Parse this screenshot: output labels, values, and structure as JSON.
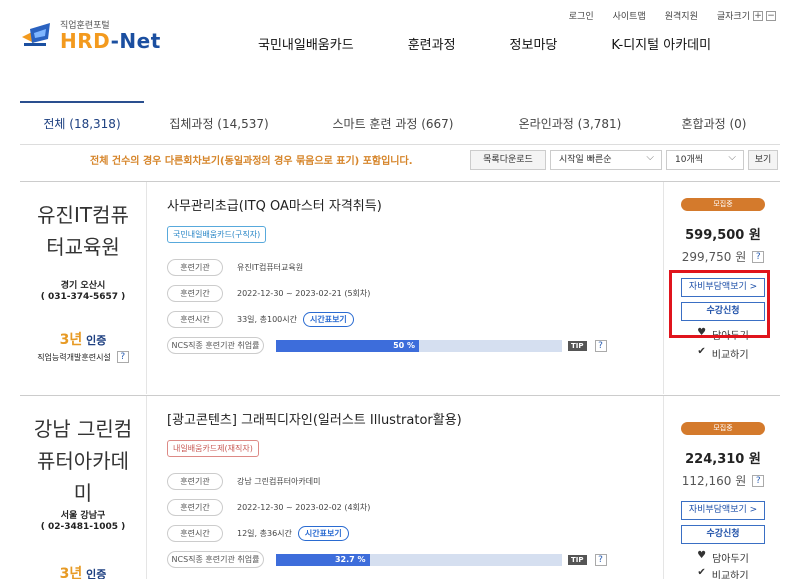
{
  "top_links": [
    "로그인",
    "사이트맵",
    "원격지원"
  ],
  "font_size": {
    "label": "글자크기",
    "plus": "+",
    "minus": "−"
  },
  "logo": {
    "sub": "직업훈련포털",
    "main_a": "HRD",
    "main_b": "-Net"
  },
  "gnb": [
    "국민내일배움카드",
    "훈련과정",
    "정보마당",
    "K-디지털 아카데미"
  ],
  "tabs": [
    "전체 (18,318)",
    "집체과정 (14,537)",
    "스마트 훈련 과정 (667)",
    "온라인과정 (3,781)",
    "혼합과정 (0)"
  ],
  "notice": "전체 건수의 경우 다른회차보기(동일과정의 경우 묶음으로 표기) 포함입니다.",
  "controls": {
    "download": "목록다운로드",
    "sort": "시작일 빠른순",
    "count": "10개씩",
    "view": "보기"
  },
  "labels": {
    "institution": "훈련기관",
    "period": "훈련기간",
    "hours": "훈련시간",
    "schedule": "시간표보기",
    "ncs": "NCS직종 훈련기관 취업률",
    "tip": "TIP",
    "recruiting": "모집중",
    "self_pay": "자비부담액보기 >",
    "apply": "수강신청",
    "wish": "담아두기",
    "compare": "비교하기",
    "q": "?"
  },
  "courses": [
    {
      "inst": "유진IT컴퓨터교육원",
      "region": "경기 오산시",
      "phone": "( 031-374-5657 )",
      "cert_num": "3년",
      "cert_label": "인증",
      "cert_sub": "직업능력개발훈련시설",
      "title": "사무관리초급(ITQ OA마스터 자격취득)",
      "type": "국민내일배움카드(구직자)",
      "inst_name": "유진IT컴퓨터교육원",
      "period": "2022-12-30 ~ 2023-02-21 (5회차)",
      "hours": "33일, 총100시간",
      "ncs_rate": 50,
      "ncs_text": "50 %",
      "price": "599,500 원",
      "self_price": "299,750 원"
    },
    {
      "inst": "강남 그린컴퓨터아카데미",
      "region": "서울 강남구",
      "phone": "( 02-3481-1005 )",
      "cert_num": "3년",
      "cert_label": "인증",
      "title": "[광고콘텐츠] 그래픽디자인(일러스트 Illustrator활용)",
      "type": "내일배움카드제(재직자)",
      "inst_name": "강남 그린컴퓨터아카데미",
      "period": "2022-12-30 ~ 2023-02-02 (4회차)",
      "hours": "12일, 총36시간",
      "ncs_rate": 32.7,
      "ncs_text": "32.7 %",
      "price": "224,310 원",
      "self_price": "112,160 원"
    }
  ],
  "colors": {
    "accent": "#1b4fa0",
    "orange": "#d47a2c",
    "highlight": "#e0141c",
    "bar": "#3d6ddb"
  }
}
